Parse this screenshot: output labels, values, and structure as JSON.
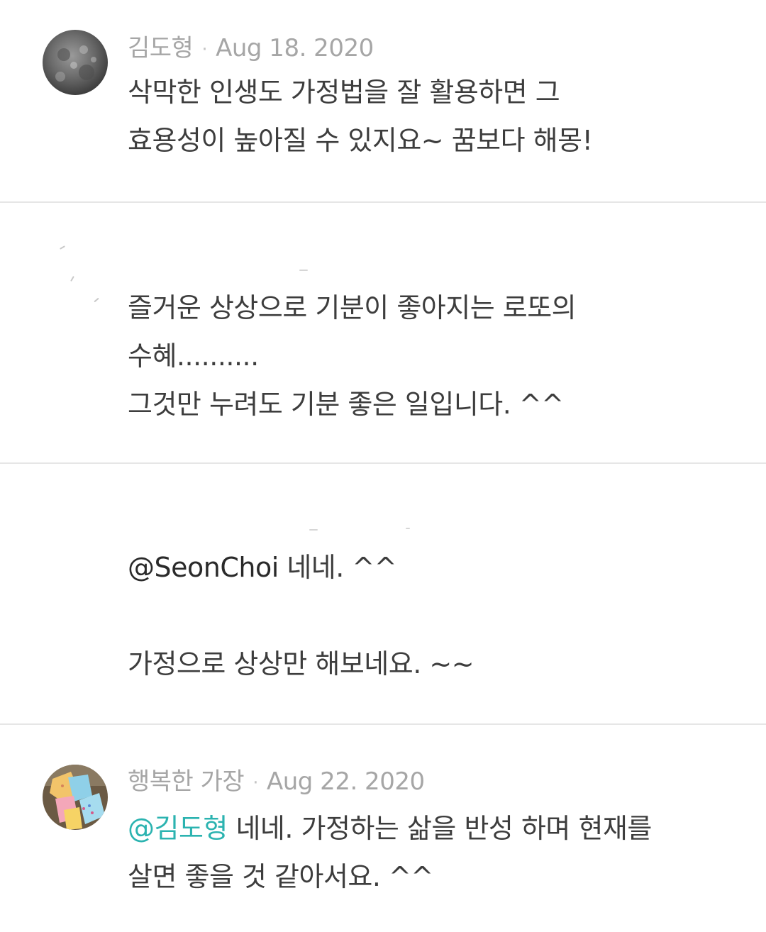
{
  "comments": [
    {
      "author": "김도형",
      "date": "Aug 18. 2020",
      "lines": [
        "삭막한 인생도 가정법을 잘 활용하면 그",
        "효용성이 높아질 수 있지요~ 꿈보다 해몽!"
      ]
    },
    {
      "author": "",
      "date": "",
      "lines": [
        "즐거운 상상으로 기분이 좋아지는 로또의",
        "수혜..........",
        "그것만 누려도 기분 좋은 일입니다. ^^"
      ]
    },
    {
      "author": "",
      "date": "",
      "mention": "@SeonChoi",
      "line1_rest": " 네네. ^^",
      "line2": "가정으로 상상만 해보네요. ~~"
    },
    {
      "author": "행복한 가장",
      "date": "Aug 22. 2020",
      "mention": "@김도형",
      "line1_rest": " 네네. 가정하는 삶을 반성 하며 현재를",
      "line2": "살면 좋을 것 같아서요. ^^"
    }
  ],
  "colors": {
    "mention": "#2bb3b0",
    "meta": "#a6a6a6",
    "text": "#3d3d3d",
    "divider": "#e6e6e6"
  },
  "icons": {
    "separator": "·"
  }
}
